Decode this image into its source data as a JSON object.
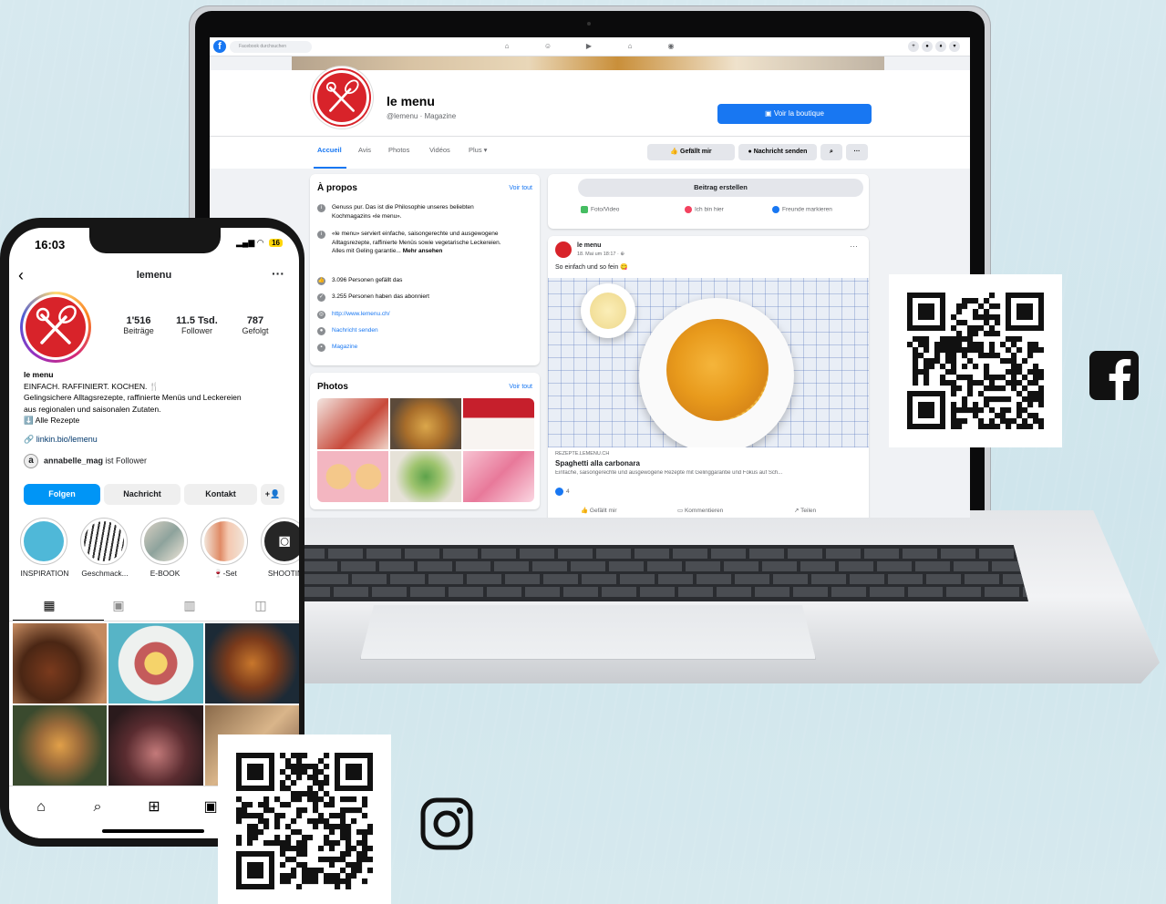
{
  "facebook": {
    "search_placeholder": "Facebook durchsuchen",
    "page_name": "le menu",
    "page_subtitle": "@lemenu · Magazine",
    "shop_button": "Voir la boutique",
    "tabs": [
      "Accueil",
      "Avis",
      "Photos",
      "Vidéos",
      "Plus ▾"
    ],
    "like_button": "Gefällt mir",
    "message_button": "Nachricht senden",
    "about": {
      "title": "À propos",
      "see_all": "Voir tout",
      "rows": [
        "Genuss pur. Das ist die Philosophie unseres beliebten Kochmagazins «le menu».",
        "«le menu» serviert einfache, saisongerechte und ausgewogene Alltagsrezepte, raffinierte Menüs sowie vegetarische Leckereien. Alles mit Geling garantie...",
        "3.096 Personen gefällt das",
        "3.255 Personen haben das abonniert",
        "http://www.lemenu.ch/",
        "Nachricht senden",
        "Magazine"
      ],
      "more_link": "Mehr ansehen"
    },
    "photos": {
      "title": "Photos",
      "see_all": "Voir tout"
    },
    "create_post": "Beitrag erstellen",
    "post_actions": [
      "Foto/Video",
      "Ich bin hier",
      "Freunde markieren"
    ],
    "post": {
      "author": "le menu",
      "date": "18. Mai um 18:17 · ⊕",
      "text": "So einfach und so fein 😋",
      "link_domain": "REZEPTE.LEMENU.CH",
      "link_title": "Spaghetti alla carbonara",
      "link_desc": "Einfache, saisongerechte und ausgewogene Rezepte mit Gelinggarantie und Fokus auf Sch...",
      "reactions": "4",
      "footer_actions": [
        "Gefällt mir",
        "Kommentieren",
        "Teilen"
      ]
    }
  },
  "instagram": {
    "time": "16:03",
    "battery": "16",
    "username": "lemenu",
    "stats": [
      {
        "number": "1'516",
        "label": "Beiträge"
      },
      {
        "number": "11.5 Tsd.",
        "label": "Follower"
      },
      {
        "number": "787",
        "label": "Gefolgt"
      }
    ],
    "bio_name": "le menu",
    "bio_lines": [
      "EINFACH. RAFFINIERT. KOCHEN. 🍴",
      "Gelingsichere Alltagsrezepte, raffinierte Menüs und Leckereien",
      "aus regionalen und saisonalen Zutaten.",
      "⬇️ Alle Rezepte"
    ],
    "link": "linkin.bio/lemenu",
    "followed_by_user": "annabelle_mag",
    "followed_by_suffix": " ist Follower",
    "buttons": [
      "Folgen",
      "Nachricht",
      "Kontakt",
      "+👤"
    ],
    "highlights": [
      "INSPIRATION",
      "Geschmack...",
      "E-BOOK",
      "🍷-Set",
      "SHOOTIN"
    ]
  },
  "colors": {
    "brand_red": "#d8232a",
    "facebook_blue": "#1877f2",
    "instagram_blue": "#0095f6"
  },
  "icons": {
    "facebook": "facebook-logo-icon",
    "instagram": "instagram-logo-icon"
  }
}
